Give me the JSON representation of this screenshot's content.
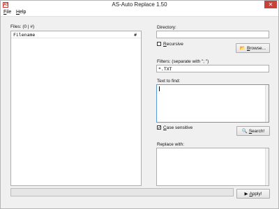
{
  "window": {
    "title": "AS-Auto Replace 1.50",
    "icon_glyph": "AS",
    "close_glyph": "✕"
  },
  "menu": {
    "file_acc": "F",
    "file_rest": "ile",
    "help_acc": "H",
    "help_rest": "elp"
  },
  "files": {
    "label": "Files: (0 | #)",
    "col_filename": "Filename",
    "col_count": "#"
  },
  "directory": {
    "label": "Directory:",
    "value": ""
  },
  "recursive": {
    "label_acc": "R",
    "label_rest": "ecursive",
    "checked": false
  },
  "browse": {
    "label_acc": "B",
    "label_rest": "rowse...",
    "icon": "folder-icon",
    "icon_glyph": "📂"
  },
  "filters": {
    "label": "Filters: (separate with \"; \")",
    "value": "*.TXT"
  },
  "find": {
    "label": "Text to find:",
    "value": ""
  },
  "case_sensitive": {
    "label_acc": "C",
    "label_rest": "ase sensitive",
    "checked": true,
    "check_glyph": "✓"
  },
  "search": {
    "label_acc": "S",
    "label_rest": "earch!",
    "icon": "magnifier-icon",
    "icon_glyph": "🔍"
  },
  "replace": {
    "label": "Replace with:",
    "value": ""
  },
  "apply": {
    "label_acc": "A",
    "label_rest": "pply!",
    "icon": "arrow-right-icon",
    "icon_glyph": "▶"
  },
  "progress": {
    "value": 0
  }
}
